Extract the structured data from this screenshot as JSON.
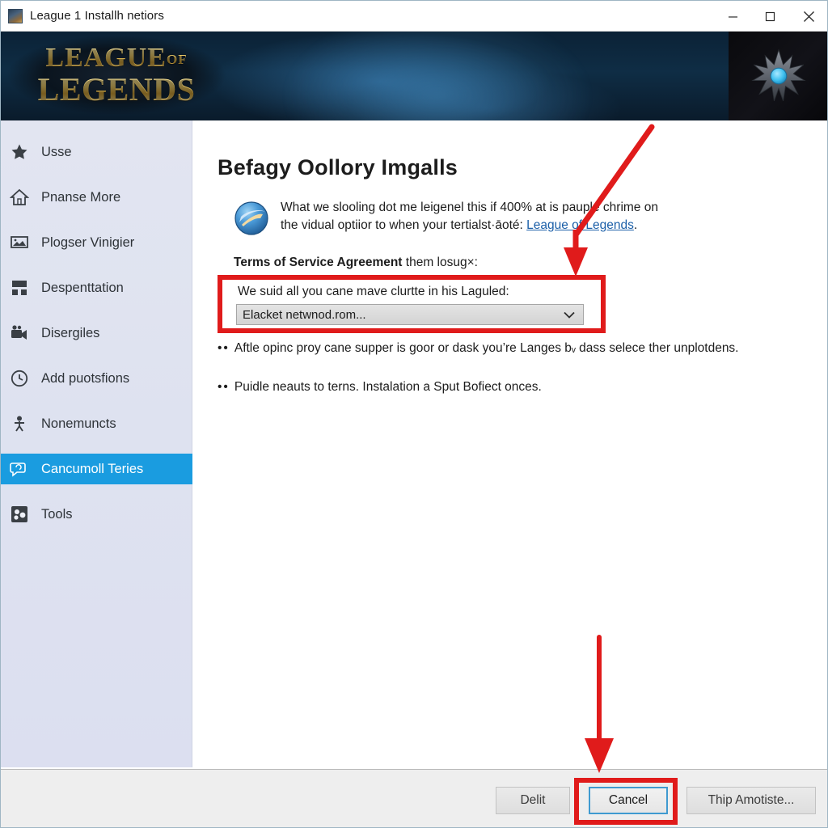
{
  "window": {
    "title": "League 1 Installh netiors",
    "icon": "app-icon",
    "controls": {
      "minimize": "minimize",
      "maximize": "maximize",
      "close": "close"
    }
  },
  "banner": {
    "logo_line1": "LEAGUE",
    "logo_of": "OF",
    "logo_line2": "LEGENDS",
    "emblem": "spiked-star-emblem",
    "bg_color": "#0b2236",
    "logo_gold": "#e8c868"
  },
  "sidebar": {
    "accent_color": "#1a9ce0",
    "bg_color": "#dee2f0",
    "items": [
      {
        "label": "Usse",
        "icon": "star-icon",
        "selected": false
      },
      {
        "label": "Pnanse More",
        "icon": "home-icon",
        "selected": false
      },
      {
        "label": "Plogser Vinigier",
        "icon": "monitor-icon",
        "selected": false
      },
      {
        "label": "Despenttation",
        "icon": "grid-icon",
        "selected": false
      },
      {
        "label": "Disergiles",
        "icon": "video-camera-icon",
        "selected": false
      },
      {
        "label": "Add puotsfions",
        "icon": "clock-icon",
        "selected": false
      },
      {
        "label": "Nonemuncts",
        "icon": "person-icon",
        "selected": false
      },
      {
        "label": "Cancumoll Teries",
        "icon": "speech-bubble-icon",
        "selected": true
      },
      {
        "label": "Tools",
        "icon": "puzzle-icon",
        "selected": false
      }
    ]
  },
  "main": {
    "page_title": "Befagy Oollory Imgalls",
    "info_icon": "internet-explorer-icon",
    "intro_line1": "What we slooling dot me leigenel this if 400% at is pauple chrime on",
    "intro_line2_before": "the vidual optiior to when your tertialst·āoté: ",
    "intro_link": "League of Legends",
    "intro_line2_after": ".",
    "tos_bold": "Terms of Service Agreement",
    "tos_rest": " them losug×:",
    "dropdown_caption": "We suid all you cane mave clurtte in his Laguled:",
    "dropdown_value": "Elacket netwnod.rom...",
    "dropdown_arrow": "chevron-down-icon",
    "bullets": [
      {
        "dots": "••",
        "text": "Aftle opinc proy cane supper is goor or dask you’re Langes bᵥ dass selece ther unplotdens."
      },
      {
        "dots": "••",
        "text": "Puidle neauts to terns. Instalation a Sput Bofiect onces."
      }
    ],
    "highlight_color": "#e01b1b"
  },
  "footer": {
    "buttons": [
      {
        "label": "Delit",
        "name": "delit-button",
        "highlighted": false
      },
      {
        "label": "Cancel",
        "name": "cancel-button",
        "highlighted": true
      },
      {
        "label": "Thip Amotiste...",
        "name": "apply-button",
        "highlighted": false
      }
    ]
  },
  "annotations": {
    "arrow_color": "#e01b1b",
    "arrow_top": "points-to-dropdown-highlight",
    "arrow_bottom": "points-to-cancel-button"
  }
}
